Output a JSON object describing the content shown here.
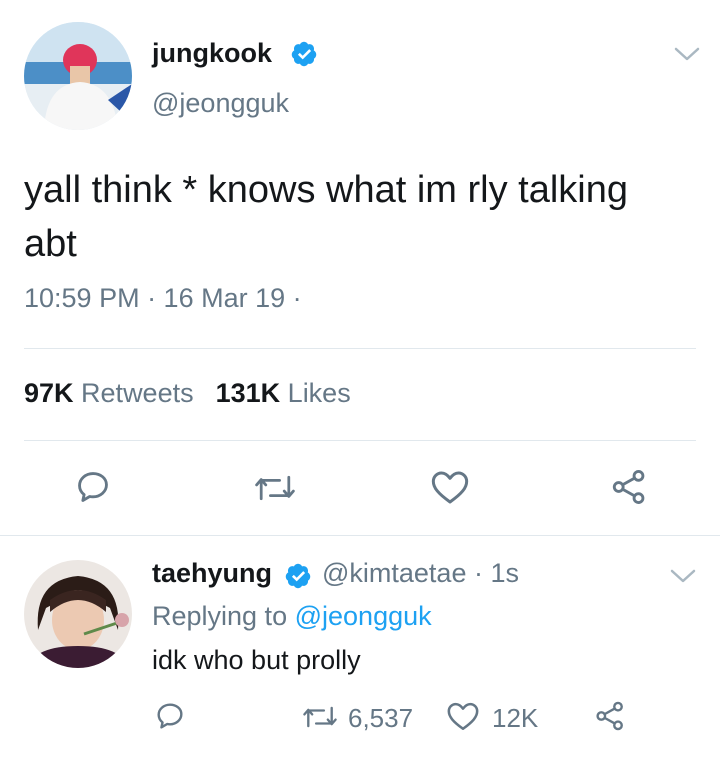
{
  "tweet": {
    "author_name": "jungkook",
    "author_handle": "@jeongguk",
    "text": "yall think * knows what im rly talking abt",
    "timestamp": "10:59 PM · 16 Mar 19 ·",
    "retweet_count": "97K",
    "retweet_label": "Retweets",
    "like_count": "131K",
    "like_label": "Likes"
  },
  "reply": {
    "author_name": "taehyung",
    "author_handle": "@kimtaetae",
    "time_ago": "· 1s",
    "replying_prefix": "Replying to",
    "replying_handle": "@jeongguk",
    "text": "idk who but prolly",
    "retweet_count": "6,537",
    "like_count": "12K"
  },
  "colors": {
    "accent": "#1da1f2",
    "secondary_text": "#657786",
    "divider": "#e1e8ed"
  },
  "icons": [
    "chevron-down-icon",
    "verified-icon",
    "reply-icon",
    "retweet-icon",
    "like-icon",
    "share-icon"
  ]
}
